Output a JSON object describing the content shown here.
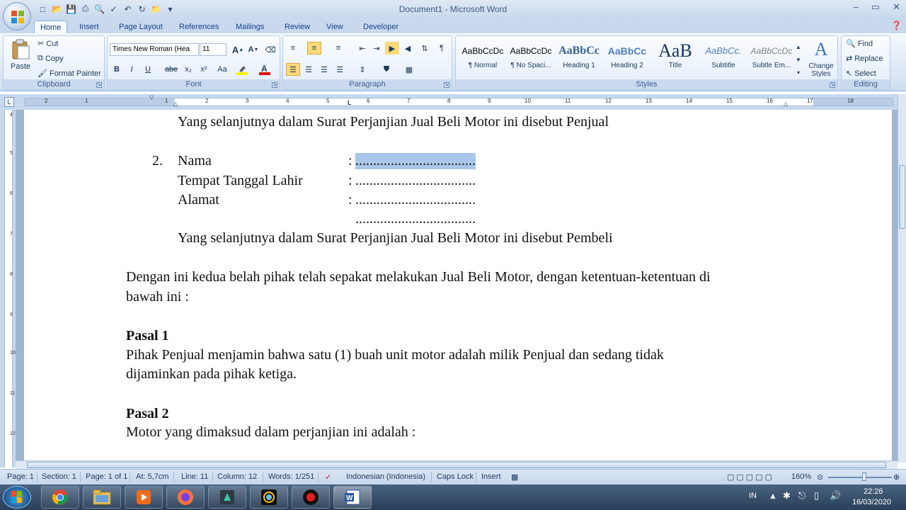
{
  "window": {
    "title": "Document1 - Microsoft Word",
    "controls": [
      "–",
      "▭",
      "✕"
    ]
  },
  "quick_access": [
    "save-icon",
    "undo-icon",
    "redo-icon"
  ],
  "tabs": [
    {
      "label": "Home",
      "active": true
    },
    {
      "label": "Insert"
    },
    {
      "label": "Page Layout"
    },
    {
      "label": "References"
    },
    {
      "label": "Mailings"
    },
    {
      "label": "Review"
    },
    {
      "label": "View"
    },
    {
      "label": "Developer"
    }
  ],
  "clipboard": {
    "paste": "Paste",
    "cut": "Cut",
    "copy": "Copy",
    "format_painter": "Format Painter",
    "label": "Clipboard"
  },
  "font": {
    "name": "Times New Roman (Hea",
    "size": "11",
    "label": "Font",
    "bold": "B",
    "italic": "I",
    "underline": "U",
    "strike": "abe",
    "subscript": "x₂",
    "superscript": "x²",
    "change_case": "Aa",
    "grow": "A",
    "shrink": "A",
    "font_color_accent": "#e01010",
    "highlight_accent": "#f7f300"
  },
  "paragraph": {
    "label": "Paragraph"
  },
  "styles": {
    "label": "Styles",
    "items": [
      {
        "preview": "AaBbCcDc",
        "name": "¶ Normal"
      },
      {
        "preview": "AaBbCcDc",
        "name": "¶ No Spaci..."
      },
      {
        "preview": "AaBbCс",
        "name": "Heading 1"
      },
      {
        "preview": "AaBbCc",
        "name": "Heading 2"
      },
      {
        "preview": "AaB",
        "name": "Title"
      },
      {
        "preview": "AaBbCc.",
        "name": "Subtitle"
      },
      {
        "preview": "AaBbCcDc",
        "name": "Subtle Em..."
      }
    ],
    "change_styles": "Change Styles"
  },
  "editing": {
    "find": "Find",
    "replace": "Replace",
    "select": "Select",
    "label": "Editing"
  },
  "ruler": {
    "numbers": [
      "2",
      "1",
      "1",
      "2",
      "3",
      "4",
      "5",
      "6",
      "7",
      "8",
      "9",
      "10",
      "11",
      "12",
      "13",
      "14",
      "15",
      "16",
      "17",
      "18"
    ],
    "vnumbers": [
      "4",
      "5",
      "6",
      "7",
      "8",
      "9",
      "10",
      "11",
      "12"
    ]
  },
  "document": {
    "line1": "Yang selanjutnya dalam Surat Perjanjian Jual Beli Motor ini disebut Penjual",
    "item_num": "2.",
    "nama_label": "Nama",
    "ttl_label": "Tempat Tanggal Lahir",
    "alamat_label": "Alamat",
    "colon": ":",
    "dots": "..................................",
    "line_pembeli": "Yang selanjutnya dalam Surat Perjanjian Jual Beli Motor ini disebut Pembeli",
    "para1a": "Dengan ini kedua belah pihak telah sepakat melakukan Jual Beli Motor, dengan ketentuan-ketentuan di",
    "para1b": "bawah ini :",
    "pasal1": "Pasal 1",
    "pasal1a": "Pihak Penjual menjamin bahwa satu (1) buah unit motor adalah milik Penjual dan sedang tidak",
    "pasal1b": "dijaminkan pada pihak ketiga.",
    "pasal2": "Pasal 2",
    "pasal2a": "Motor yang dimaksud dalam perjanjian ini adalah :"
  },
  "status": {
    "page": "Page: 1",
    "section": "Section: 1",
    "page_of": "Page: 1 of 1",
    "at": "At: 5,7cm",
    "line": "Line: 11",
    "column": "Column: 12",
    "words": "Words: 1/251",
    "language": "Indonesian (Indonesia)",
    "caps": "Caps Lock",
    "insert": "Insert",
    "zoom": "160%"
  },
  "taskbar": {
    "apps": [
      "chrome-icon",
      "file-explorer-icon",
      "media-player-icon",
      "firefox-icon",
      "video-editor-icon",
      "camera-icon",
      "record-icon",
      "word-icon"
    ],
    "lang": "IN",
    "time": "22:26",
    "date": "16/03/2020"
  }
}
